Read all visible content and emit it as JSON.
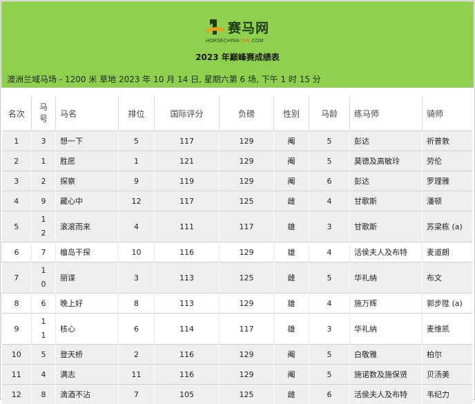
{
  "logo": {
    "brand": "赛马网",
    "sub_main": "HORSECHINA",
    "sub_accent": "ONE",
    "sub_tail": ".COM"
  },
  "title": "2023 年巅峰赛成绩表",
  "race_info": "澳洲兰域马场  - 1200 米  草地 2023 年 10 月 14 日, 星期六第 6 场, 下午 1 时 15 分",
  "columns": [
    "名次",
    "马号",
    "马名",
    "排位",
    "国际评分",
    "负磅",
    "性别",
    "马龄",
    "练马师",
    "骑师"
  ],
  "rows": [
    {
      "rank": "1",
      "no": "3",
      "name": "想一下",
      "draw": "5",
      "rating": "117",
      "weight": "129",
      "sex": "阉",
      "age": "5",
      "trainer": "彭达",
      "jockey": "祈普敦"
    },
    {
      "rank": "2",
      "no": "1",
      "name": "胜愿",
      "draw": "1",
      "rating": "121",
      "weight": "129",
      "sex": "阉",
      "age": "5",
      "trainer": "莫德及高敏玲",
      "jockey": "劳伦"
    },
    {
      "rank": "3",
      "no": "2",
      "name": "探察",
      "draw": "9",
      "rating": "119",
      "weight": "129",
      "sex": "阉",
      "age": "6",
      "trainer": "彭达",
      "jockey": "罗理雅"
    },
    {
      "rank": "4",
      "no": "9",
      "name": "藏心中",
      "draw": "12",
      "rating": "117",
      "weight": "125",
      "sex": "雌",
      "age": "4",
      "trainer": "甘歌斯",
      "jockey": "潘顿"
    },
    {
      "rank": "5",
      "no": "12",
      "name": "滚滚而来",
      "draw": "4",
      "rating": "111",
      "weight": "117",
      "sex": "雄",
      "age": "3",
      "trainer": "甘歌斯",
      "jockey": "苏梁栋 (a)"
    },
    {
      "rank": "6",
      "no": "7",
      "name": "檀岛干探",
      "draw": "10",
      "rating": "116",
      "weight": "129",
      "sex": "雄",
      "age": "4",
      "trainer": "活侯夫人及布特",
      "jockey": "麦道朗"
    },
    {
      "rank": "7",
      "no": "10",
      "name": "丽谍",
      "draw": "3",
      "rating": "113",
      "weight": "125",
      "sex": "雌",
      "age": "5",
      "trainer": "华礼纳",
      "jockey": "布文"
    },
    {
      "rank": "8",
      "no": "6",
      "name": "晚上好",
      "draw": "8",
      "rating": "113",
      "weight": "129",
      "sex": "雄",
      "age": "4",
      "trainer": "施万辉",
      "jockey": "郭步陞 (a)"
    },
    {
      "rank": "9",
      "no": "11",
      "name": "核心",
      "draw": "6",
      "rating": "114",
      "weight": "117",
      "sex": "雄",
      "age": "3",
      "trainer": "华礼纳",
      "jockey": "麦维凯"
    },
    {
      "rank": "10",
      "no": "5",
      "name": "登天桥",
      "draw": "2",
      "rating": "116",
      "weight": "129",
      "sex": "阉",
      "age": "5",
      "trainer": "白敬雅",
      "jockey": "柏尔"
    },
    {
      "rank": "11",
      "no": "4",
      "name": "满志",
      "draw": "11",
      "rating": "116",
      "weight": "129",
      "sex": "阉",
      "age": "5",
      "trainer": "施诺数及施保贤",
      "jockey": "贝汤美"
    },
    {
      "rank": "12",
      "no": "8",
      "name": "滴酒不沾",
      "draw": "7",
      "rating": "105",
      "weight": "125",
      "sex": "雌",
      "age": "6",
      "trainer": "活侯夫人及布特",
      "jockey": "韦纪力"
    }
  ]
}
